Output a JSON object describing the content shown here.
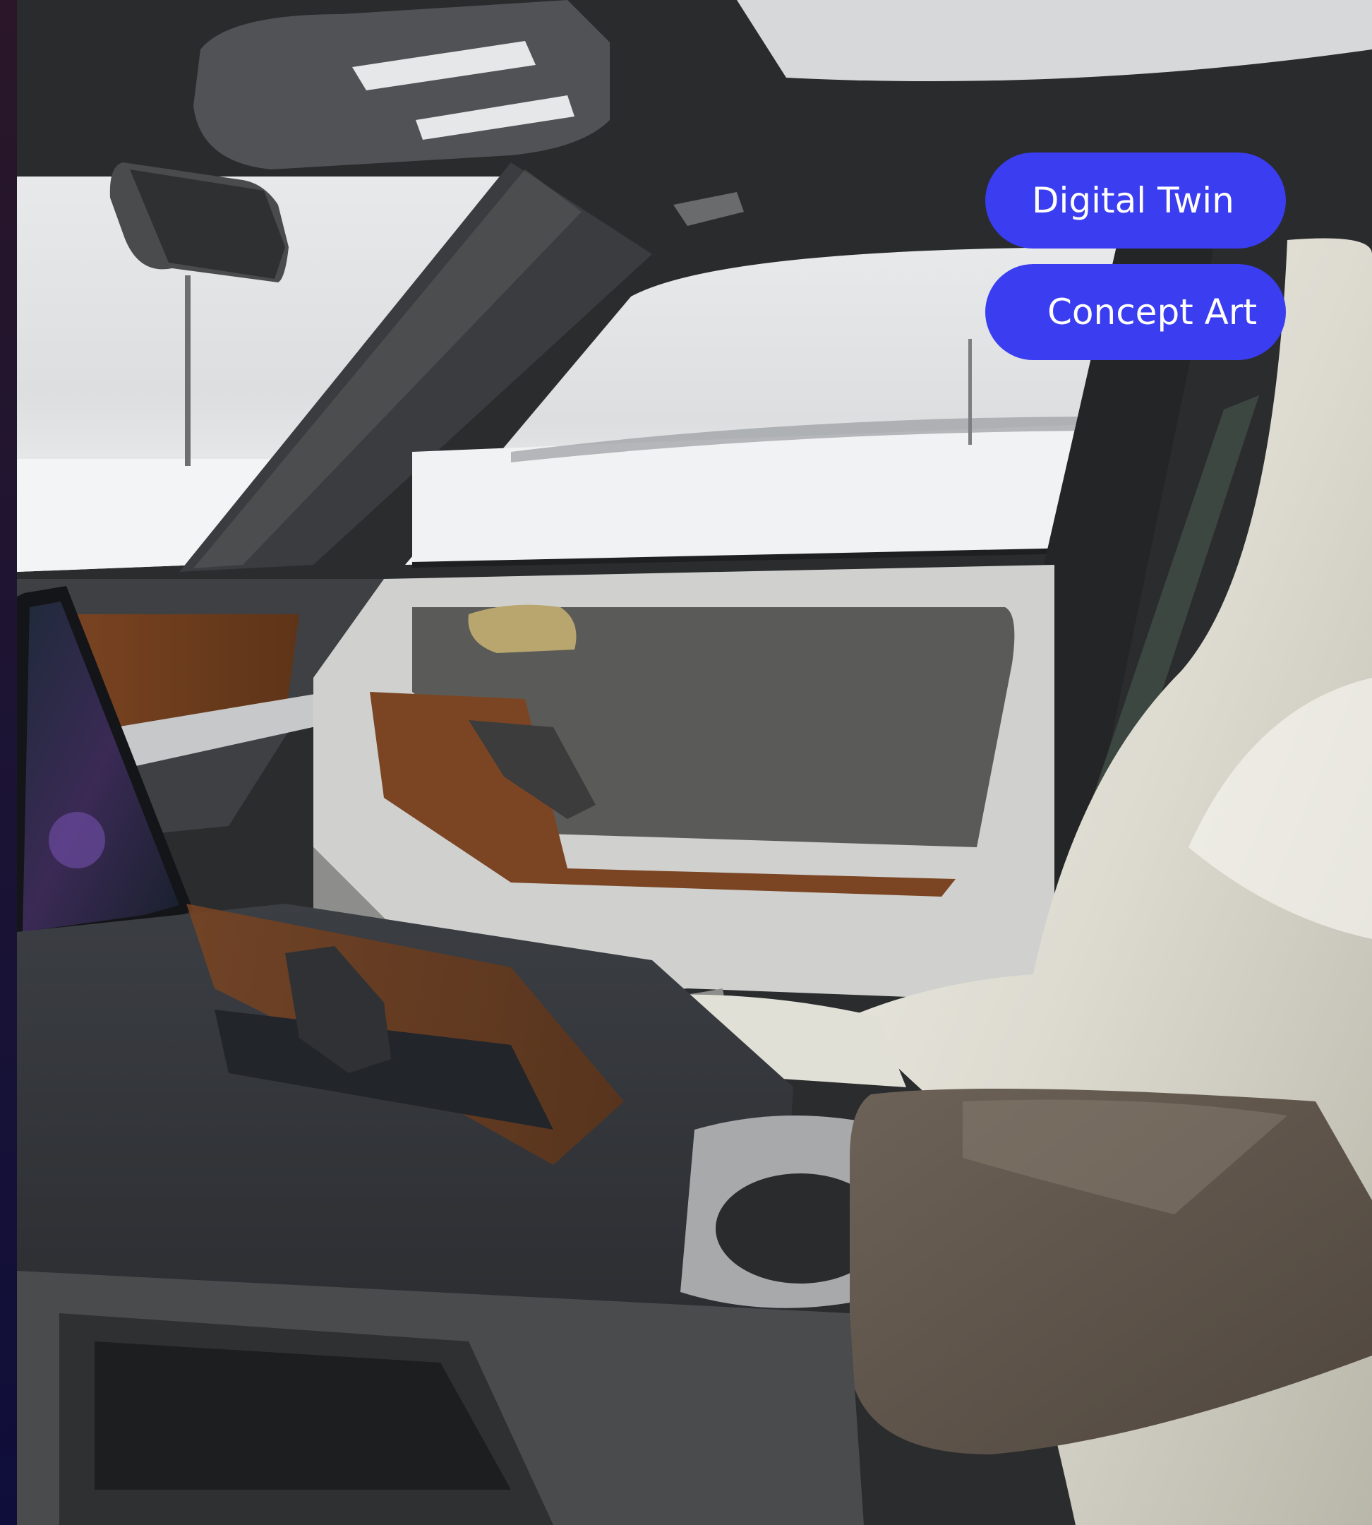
{
  "buttons": {
    "digital_twin": "Digital Twin",
    "concept_art": "Concept Art"
  },
  "colors": {
    "button_bg": "#3a3df0",
    "button_text": "#ffffff",
    "page_edge": "#1d1433"
  }
}
